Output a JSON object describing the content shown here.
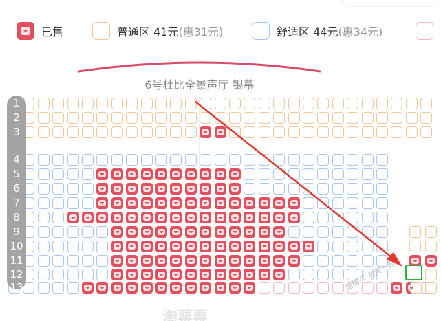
{
  "legend": {
    "sold": {
      "label": "已售",
      "icon": "sold-seat-icon",
      "color": "#e2505f"
    },
    "standard": {
      "label": "普通区 41元",
      "sub": "(惠31元)",
      "color": "#f0c79a"
    },
    "comfort": {
      "label": "舒适区 44元",
      "sub": "(惠34元)",
      "color": "#a9c8ea"
    },
    "extra": {
      "color": "#f4b8c8"
    }
  },
  "screen": {
    "label": "6号杜比全景声厅 银幕",
    "accent": "#d94a6a"
  },
  "rows": [
    "1",
    "2",
    "3",
    "4",
    "5",
    "6",
    "7",
    "8",
    "9",
    "10",
    "11",
    "12",
    "13"
  ],
  "watermark": "淘票票",
  "watermark_small": "值得买·有奖一起",
  "colors": {
    "selected": "#2fae3c",
    "arrow": "#e03a2e"
  }
}
